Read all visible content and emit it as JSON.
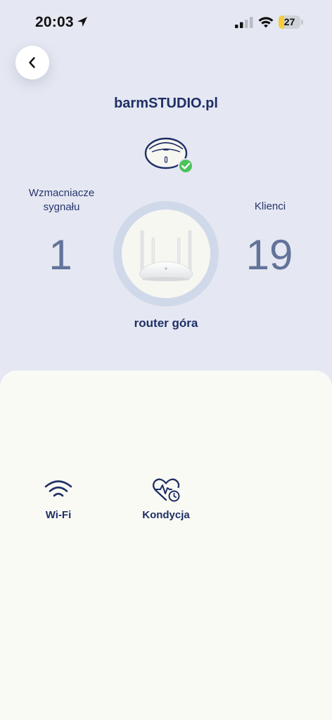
{
  "status_bar": {
    "time": "20:03",
    "battery_level": "27",
    "battery_fraction": 0.27,
    "battery_color": "#f6cc3a",
    "icons": [
      "location-arrow-icon",
      "cellular-signal-icon",
      "wifi-icon",
      "battery-icon"
    ]
  },
  "header": {
    "back_icon": "chevron-left-icon",
    "network_name": "barmSTUDIO.pl"
  },
  "stats": {
    "extenders_label": "Wzmacniacze sygnału",
    "extenders_count": "1",
    "clients_label": "Klienci",
    "clients_count": "19"
  },
  "router": {
    "name": "router góra",
    "satellite_status_icon": "check-circle-icon",
    "status_color": "#4cc35a"
  },
  "actions": [
    {
      "label": "Wi-Fi",
      "icon": "wifi-icon"
    },
    {
      "label": "Kondycja",
      "icon": "heart-pulse-clock-icon"
    }
  ],
  "colors": {
    "background": "#e5e8f2",
    "sheet": "#fafaf5",
    "primary_text": "#1f2f66",
    "stat_number": "#63739a"
  }
}
